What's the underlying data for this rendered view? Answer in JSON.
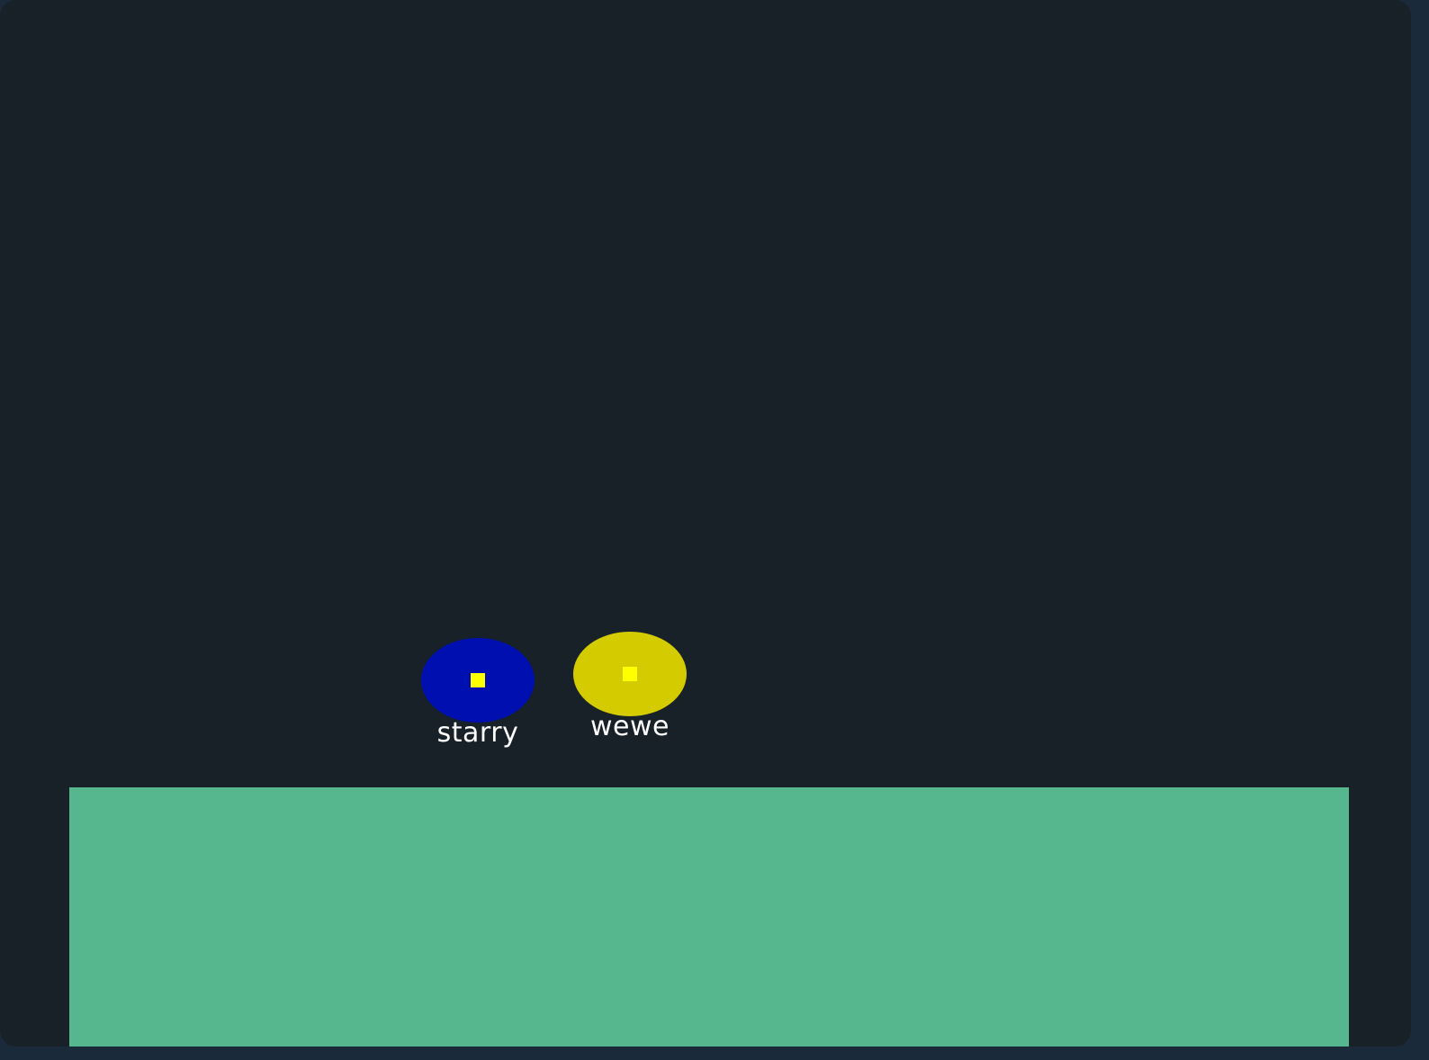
{
  "colors": {
    "background": "#182028",
    "ground": "#56b68d",
    "eye": "#ffff00"
  },
  "players": [
    {
      "name": "starry",
      "color": "#0010b0"
    },
    {
      "name": "wewe",
      "color": "#d4cc00"
    }
  ]
}
